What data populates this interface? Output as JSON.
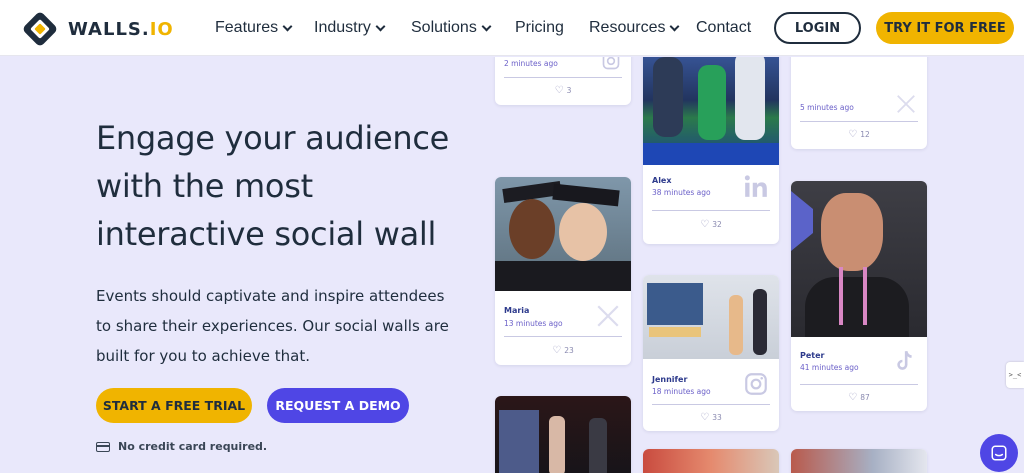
{
  "brand": {
    "name_main": "WALLS.",
    "name_accent": "IO"
  },
  "nav": {
    "features": "Features",
    "industry": "Industry",
    "solutions": "Solutions",
    "pricing": "Pricing",
    "resources": "Resources",
    "contact": "Contact",
    "login": "LOGIN",
    "try": "TRY IT FOR FREE"
  },
  "hero": {
    "headline_line1": "Engage your audience",
    "headline_line2": "with the most",
    "headline_line3": "interactive social wall",
    "subtext_line1": "Events should captivate and inspire attendees",
    "subtext_line2": "to share their experiences. Our social walls are",
    "subtext_line3": "built for you to achieve that.",
    "cta_trial": "START A FREE TRIAL",
    "cta_demo": "REQUEST A DEMO",
    "note": "No credit card required."
  },
  "posts": [
    {
      "time": "2 minutes ago",
      "likes": "3",
      "network": "instagram-icon"
    },
    {
      "author": "Alex",
      "time": "38 minutes ago",
      "likes": "32",
      "network": "linkedin-icon"
    },
    {
      "time": "5 minutes ago",
      "likes": "12",
      "network": "x-icon"
    },
    {
      "author": "Maria",
      "time": "13 minutes ago",
      "likes": "23",
      "network": "x-icon"
    },
    {
      "author": "Jennifer",
      "time": "18 minutes ago",
      "likes": "33",
      "network": "instagram-icon"
    },
    {
      "author": "Peter",
      "time": "41 minutes ago",
      "likes": "87",
      "network": "tiktok-icon"
    }
  ],
  "widgets": {
    "side_tab": ">_<"
  },
  "colors": {
    "accent": "#f0b400",
    "primary": "#4f46e5",
    "background": "#e9e8fb",
    "text": "#1f2d3d"
  }
}
